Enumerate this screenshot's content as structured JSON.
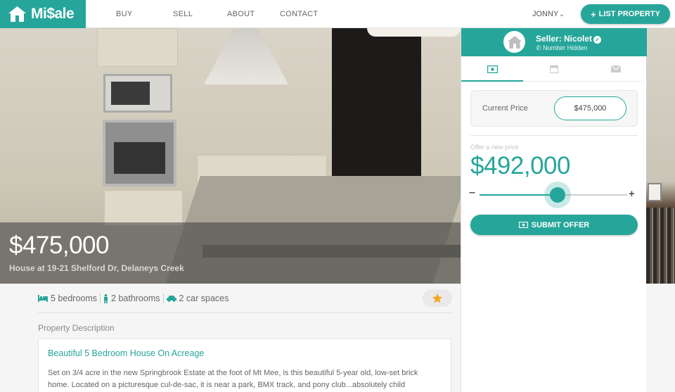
{
  "brand": {
    "name": "Mi$ale"
  },
  "nav": {
    "links": [
      "BUY",
      "SELL",
      "ABOUT",
      "CONTACT"
    ],
    "user": "JONNY",
    "list_property": "LIST PROPERTY"
  },
  "hero": {
    "price": "$475,000",
    "address": "House at 19-21 Shelford Dr, Delaneys Creek"
  },
  "seller": {
    "name": "Seller: Nicolet",
    "phone": "Number Hidden"
  },
  "tabs": [
    "offer-tab",
    "calendar-tab",
    "message-tab"
  ],
  "offer": {
    "current_price_label": "Current Price",
    "current_price": "$475,000",
    "hint": "Offer a new price",
    "amount": "$492,000",
    "slider_level": 0.53,
    "submit": "SUBMIT OFFER"
  },
  "features": {
    "bedrooms": "5 bedrooms",
    "bathrooms": "2 bathrooms",
    "cars": "2 car spaces"
  },
  "description": {
    "label": "Property Description",
    "title": "Beautiful 5 Bedroom House On Acreage",
    "text": "Set on 3/4 acre in the new Springbrook Estate at the foot of Mt Mee, is this beautiful 5-year old, low-set brick home. Located on a picturesque cul-de-sac, it is near a park, BMX track, and pony club...absolutely child"
  },
  "colors": {
    "accent": "#26a69a",
    "star": "#f5a623"
  }
}
